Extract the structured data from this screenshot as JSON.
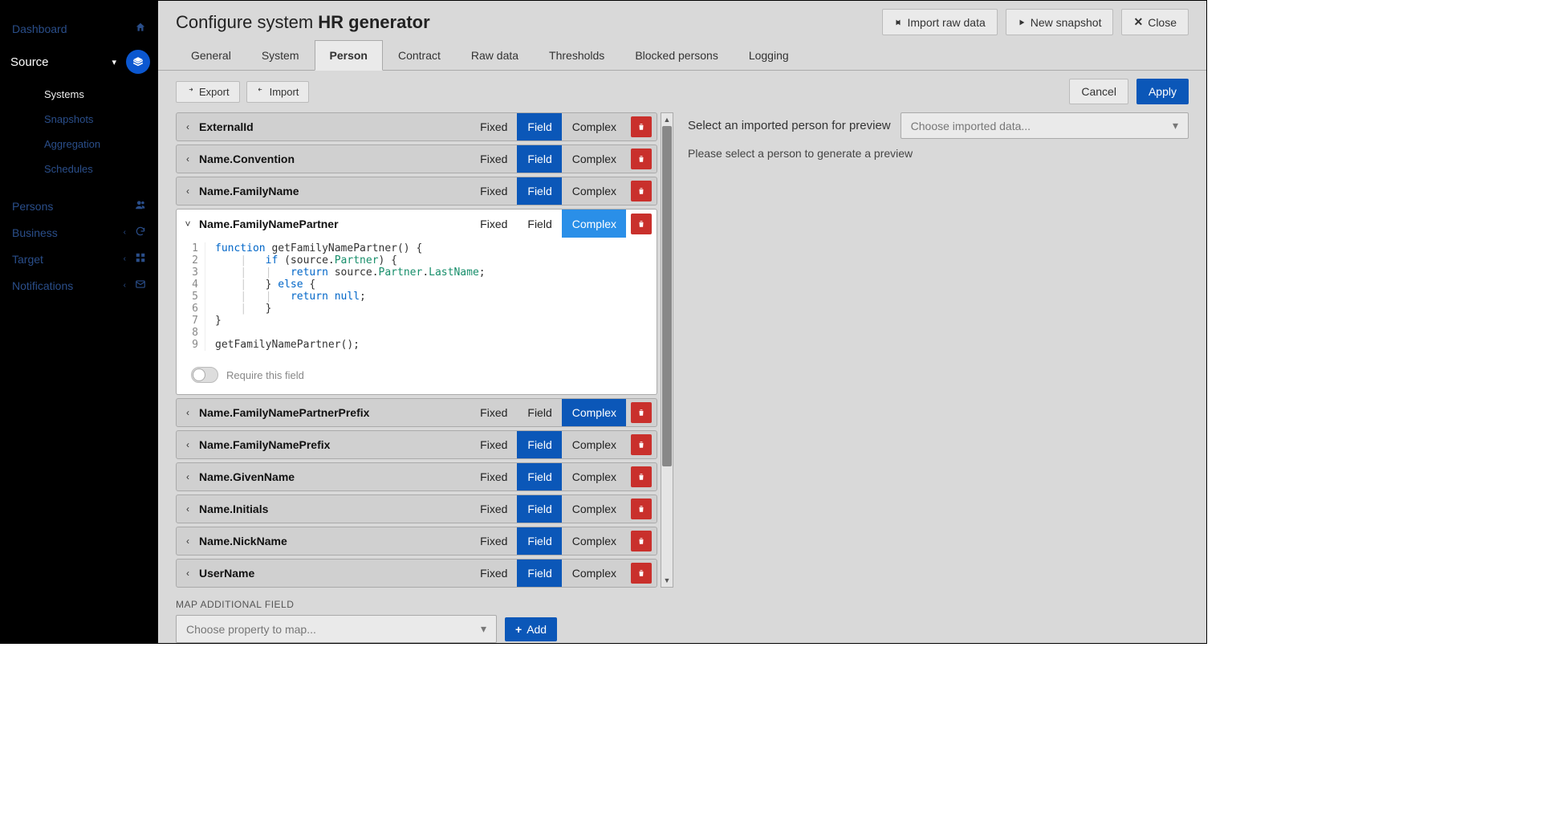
{
  "header": {
    "prefix": "Configure system ",
    "title": "HR generator",
    "import_raw": "Import raw data",
    "new_snapshot": "New snapshot",
    "close": "Close"
  },
  "sidebar": {
    "dashboard": "Dashboard",
    "source": "Source",
    "systems": "Systems",
    "snapshots": "Snapshots",
    "aggregation": "Aggregation",
    "schedules": "Schedules",
    "persons": "Persons",
    "business": "Business",
    "target": "Target",
    "notifications": "Notifications"
  },
  "tabs": [
    "General",
    "System",
    "Person",
    "Contract",
    "Raw data",
    "Thresholds",
    "Blocked persons",
    "Logging"
  ],
  "active_tab": 2,
  "toolbar": {
    "export": "Export",
    "import": "Import",
    "cancel": "Cancel",
    "apply": "Apply"
  },
  "preview": {
    "label": "Select an imported person for preview",
    "placeholder": "Choose imported data...",
    "msg": "Please select a person to generate a preview"
  },
  "seg_labels": {
    "fixed": "Fixed",
    "field": "Field",
    "complex": "Complex"
  },
  "fields": [
    {
      "name": "ExternalId",
      "field": true,
      "complex": false,
      "expanded": false
    },
    {
      "name": "Name.Convention",
      "field": true,
      "complex": false,
      "expanded": false
    },
    {
      "name": "Name.FamilyName",
      "field": true,
      "complex": false,
      "expanded": false
    },
    {
      "name": "Name.FamilyNamePartner",
      "field": false,
      "complex": true,
      "complex_light": true,
      "expanded": true
    },
    {
      "name": "Name.FamilyNamePartnerPrefix",
      "field": false,
      "complex": true,
      "complex_light": false,
      "expanded": false
    },
    {
      "name": "Name.FamilyNamePrefix",
      "field": true,
      "complex": false,
      "expanded": false
    },
    {
      "name": "Name.GivenName",
      "field": true,
      "complex": false,
      "expanded": false
    },
    {
      "name": "Name.Initials",
      "field": true,
      "complex": false,
      "expanded": false
    },
    {
      "name": "Name.NickName",
      "field": true,
      "complex": false,
      "expanded": false
    },
    {
      "name": "UserName",
      "field": true,
      "complex": false,
      "expanded": false
    }
  ],
  "code_lines": [
    "1",
    "2",
    "3",
    "4",
    "5",
    "6",
    "7",
    "8",
    "9"
  ],
  "require_label": "Require this field",
  "map": {
    "label": "MAP ADDITIONAL FIELD",
    "placeholder": "Choose property to map...",
    "add": "Add"
  }
}
